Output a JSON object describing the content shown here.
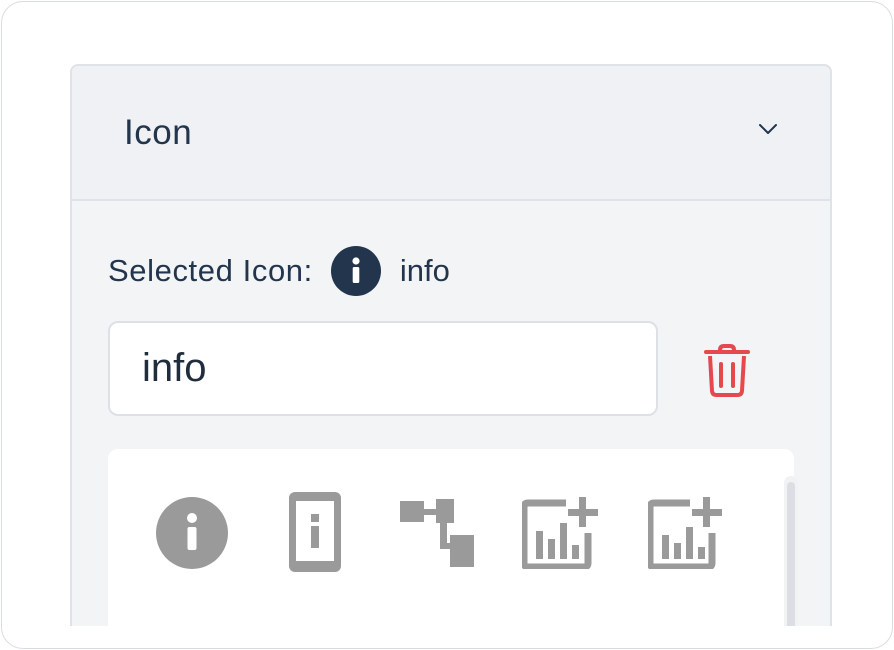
{
  "panel": {
    "title": "Icon",
    "toggle_icon": "chevron-down-icon"
  },
  "selected": {
    "label": "Selected Icon:",
    "icon": "info-icon",
    "name": "info"
  },
  "search": {
    "value": "info"
  },
  "delete": {
    "icon": "trash-icon",
    "color": "#e5484d"
  },
  "icon_grid": {
    "items": [
      "info-icon",
      "phone-info-icon",
      "hierarchy-icon",
      "add-chart-icon",
      "add-chart-alt-icon"
    ],
    "icon_color": "#9a9a9a"
  },
  "colors": {
    "text": "#22354d",
    "accent": "#22354d"
  }
}
